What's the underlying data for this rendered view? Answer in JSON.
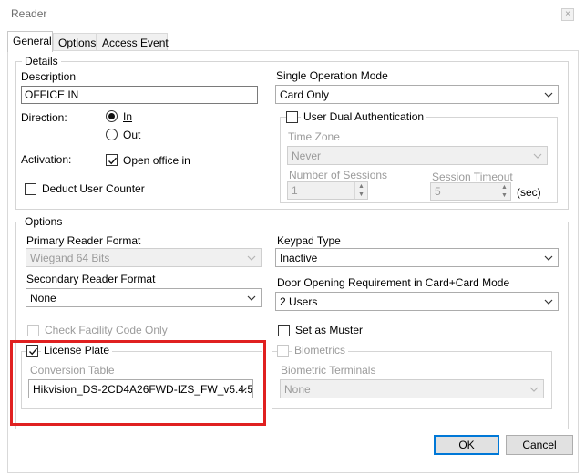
{
  "window": {
    "title": "Reader",
    "close_glyph": "×"
  },
  "tabs": [
    {
      "label": "General",
      "active": true
    },
    {
      "label": "Options",
      "active": false
    },
    {
      "label": "Access Event",
      "active": false
    }
  ],
  "details": {
    "legend": "Details",
    "description_label": "Description",
    "description_value": "OFFICE IN",
    "direction_label": "Direction:",
    "direction_options": [
      "In",
      "Out"
    ],
    "direction_selected": "In",
    "activation_label": "Activation:",
    "activation_checkbox_label": "Open office in",
    "activation_checked": true,
    "deduct_user_counter_label": "Deduct User Counter",
    "deduct_user_counter_checked": false,
    "single_operation_mode_label": "Single Operation Mode",
    "single_operation_mode_value": "Card Only",
    "user_dual_auth_label": "User Dual Authentication",
    "user_dual_auth_checked": false,
    "time_zone_label": "Time Zone",
    "time_zone_value": "Never",
    "number_of_sessions_label": "Number of Sessions",
    "number_of_sessions_value": "1",
    "session_timeout_label": "Session Timeout",
    "session_timeout_value": "5",
    "session_timeout_unit": "(sec)"
  },
  "options": {
    "legend": "Options",
    "primary_reader_format_label": "Primary Reader Format",
    "primary_reader_format_value": "Wiegand 64 Bits",
    "secondary_reader_format_label": "Secondary Reader Format",
    "secondary_reader_format_value": "None",
    "check_facility_code_label": "Check Facility Code Only",
    "check_facility_code_checked": false,
    "keypad_type_label": "Keypad Type",
    "keypad_type_value": "Inactive",
    "door_opening_label": "Door Opening Requirement in Card+Card Mode",
    "door_opening_value": "2 Users",
    "set_as_muster_label": "Set as Muster",
    "set_as_muster_checked": false,
    "license_plate_label": "License Plate",
    "license_plate_checked": true,
    "conversion_table_label": "Conversion Table",
    "conversion_table_value": "Hikvision_DS-2CD4A26FWD-IZS_FW_v5.4.5",
    "biometrics_label": "Biometrics",
    "biometrics_checked": false,
    "biometric_terminals_label": "Biometric Terminals",
    "biometric_terminals_value": "None"
  },
  "buttons": {
    "ok": "OK",
    "cancel": "Cancel"
  },
  "colors": {
    "highlight_frame": "#e02020",
    "default_button_border": "#0078d7"
  }
}
